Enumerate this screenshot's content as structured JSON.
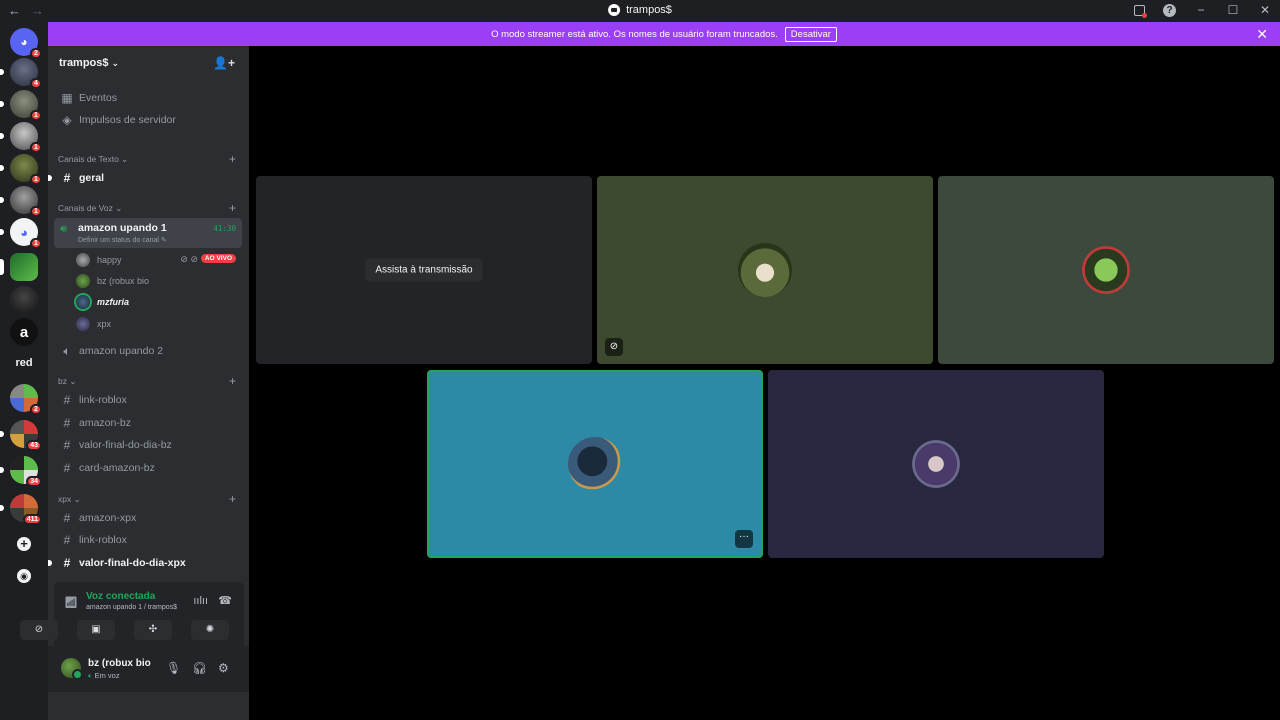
{
  "titlebar": {
    "title": "trampos$"
  },
  "banner": {
    "message": "O modo streamer está ativo. Os nomes de usuário foram truncados.",
    "button_label": "Desativar"
  },
  "rail": {
    "badges": [
      "2",
      "4",
      "1",
      "1",
      "1",
      "1",
      "1",
      "43",
      "34",
      "411",
      "2"
    ],
    "text_server": "red"
  },
  "server": {
    "name": "trampos$"
  },
  "sidebar": {
    "events": "Eventos",
    "boosts": "Impulsos de servidor",
    "cat_text": "Canais de Texto",
    "cat_voice": "Canais de Voz",
    "ch_geral": "geral",
    "voice1": {
      "name": "amazon upando 1",
      "status": "Definir um status do canal",
      "time": "41:30"
    },
    "voice_users": [
      "happy",
      "bz (robux bio",
      "mzfuria",
      "xpx"
    ],
    "live_label": "AO VIVO",
    "voice2": "amazon upando 2",
    "cat_bz": "bz",
    "bz_channels": [
      "link-roblox",
      "amazon-bz",
      "valor-final-do-dia-bz",
      "card-amazon-bz"
    ],
    "cat_xpx": "xpx",
    "xpx_channels": [
      "amazon-xpx",
      "link-roblox",
      "valor-final-do-dia-xpx"
    ]
  },
  "voice_panel": {
    "title": "Voz conectada",
    "subtitle": "amazon upando 1 / trampos$"
  },
  "user": {
    "name": "bz (robux bio",
    "status": "Em voz"
  },
  "stage": {
    "watch_label": "Assista à transmissão"
  },
  "colors": {
    "accent": "#9b3ff6",
    "online": "#23a55a",
    "danger": "#f23f42",
    "tile_speaking": "#2d8aa6",
    "tile_green": "#3d4a2f",
    "tile_gray": "#3c4a3e",
    "tile_purple": "#2a2740"
  }
}
